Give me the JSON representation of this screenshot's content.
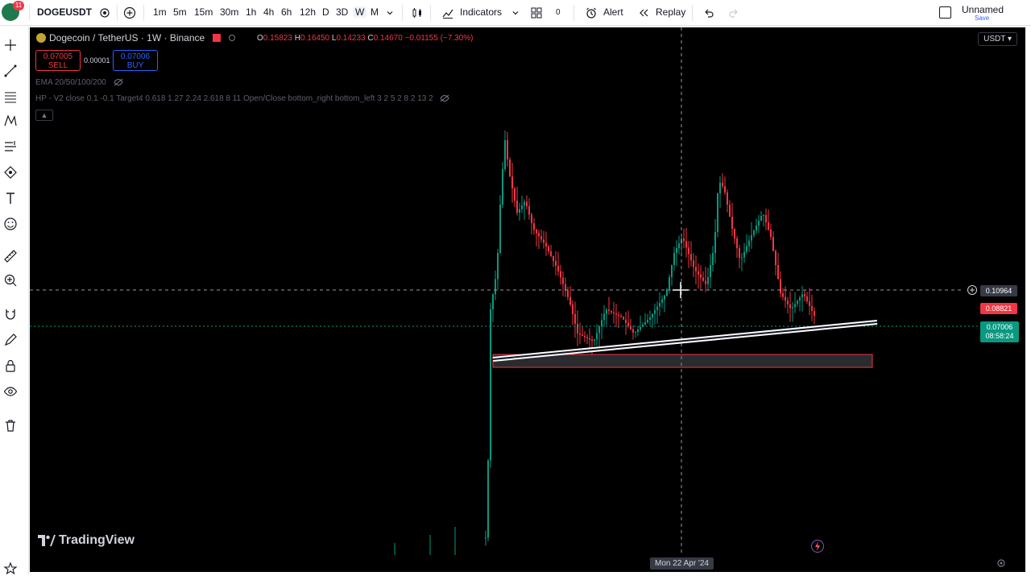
{
  "toolbar": {
    "avatar_badge": "11",
    "symbol": "DOGEUSDT",
    "timeframes": [
      "1m",
      "5m",
      "15m",
      "30m",
      "1h",
      "4h",
      "6h",
      "12h",
      "D",
      "3D",
      "W",
      "M"
    ],
    "active_timeframe": "W",
    "indicators_label": "Indicators",
    "layout_count": "0",
    "alert_label": "Alert",
    "replay_label": "Replay",
    "layout_name": "Unnamed",
    "save_label": "Save"
  },
  "legend": {
    "title": "Dogecoin / TetherUS · 1W · Binance",
    "open_label": "O",
    "open": "0.15823",
    "high_label": "H",
    "high": "0.16450",
    "low_label": "L",
    "low": "0.14233",
    "close_label": "C",
    "close": "0.14670",
    "change": "−0.01155 (−7.30%)",
    "sell_price": "0.07005",
    "sell_label": "SELL",
    "spread": "0.00001",
    "buy_price": "0.07006",
    "buy_label": "BUY",
    "ema": "EMA 20/50/100/200",
    "hp": "HP - V2 close 0.1 -0.1 Target4 0.618 1.27 2.24 2.618 8 11 Open/Close bottom_right bottom_left 3 2 5 2 8 2 13 2"
  },
  "price_axis": {
    "currency": "USDT",
    "crosshair_price": "0.10964",
    "red_label": "0.08821",
    "last_price": "0.07006",
    "countdown": "08:58:24"
  },
  "time_axis": {
    "crosshair_date": "Mon 22 Apr '24"
  },
  "watermark": "TradingView",
  "colors": {
    "up": "#089981",
    "down": "#f23645",
    "accent": "#2962ff"
  }
}
